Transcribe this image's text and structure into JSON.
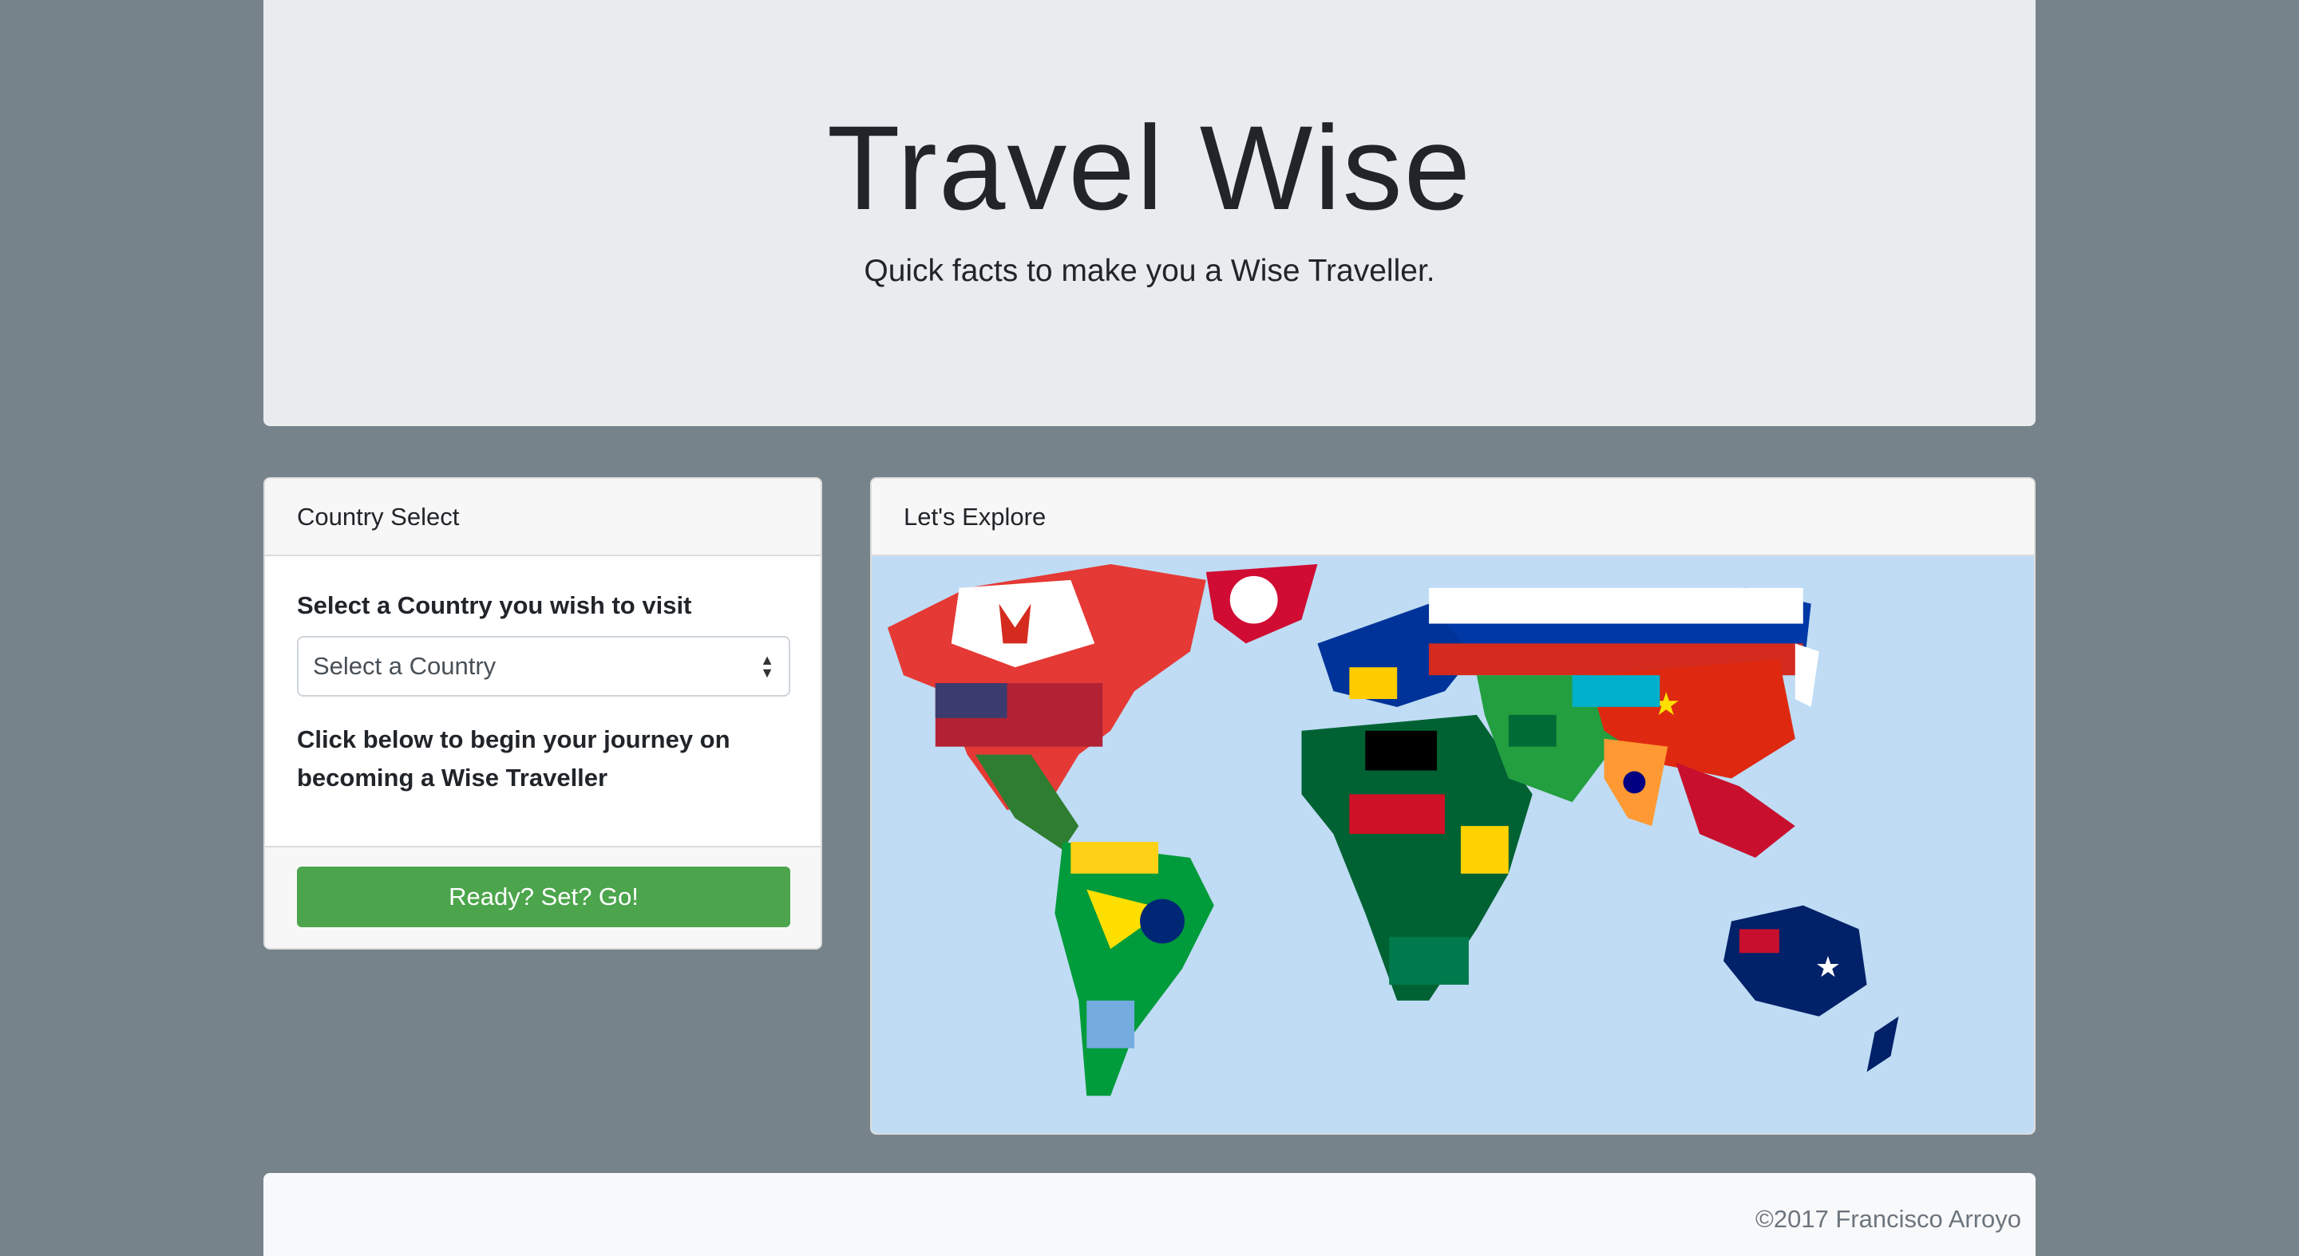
{
  "header": {
    "title": "Travel Wise",
    "subtitle": "Quick facts to make you a Wise Traveller."
  },
  "country_select": {
    "header": "Country Select",
    "label": "Select a Country you wish to visit",
    "select_value": "Select a Country",
    "instruction": "Click below to begin your journey on becoming a Wise Traveller",
    "button_label": "Ready? Set? Go!"
  },
  "explore": {
    "header": "Let's Explore",
    "map_icon": "world-flag-map"
  },
  "footer": {
    "copyright": "©2017 Francisco Arroyo"
  },
  "colors": {
    "page_background": "#77838b",
    "jumbotron": "#e9ecef",
    "button": "#4ca54c",
    "ocean": "#bfdcf4"
  }
}
